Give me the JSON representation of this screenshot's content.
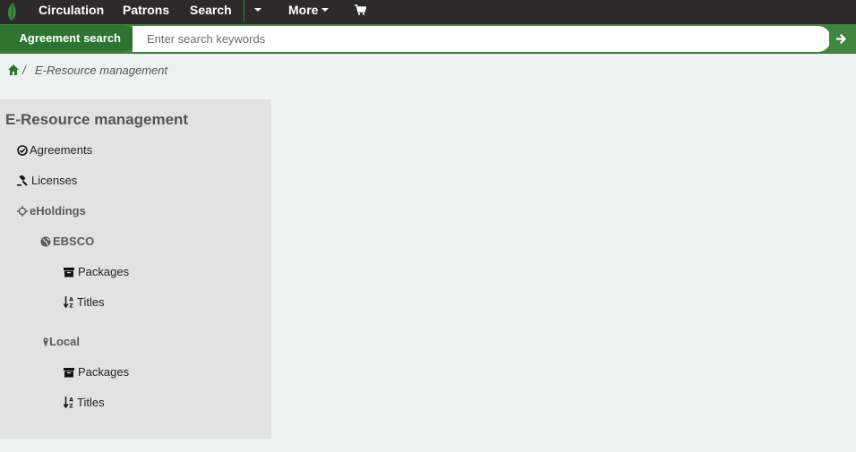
{
  "topnav": {
    "items": [
      {
        "label": "Circulation"
      },
      {
        "label": "Patrons"
      },
      {
        "label": "Search"
      },
      {
        "label": "More"
      }
    ],
    "brand_color": "#408540"
  },
  "search": {
    "label": "Agreement search",
    "placeholder": "Enter search keywords",
    "value": ""
  },
  "breadcrumb": {
    "separator": "/",
    "current": "E-Resource management"
  },
  "sidebar": {
    "title": "E-Resource management",
    "items": [
      {
        "label": "Agreements",
        "icon": "check-circle-icon"
      },
      {
        "label": "Licenses",
        "icon": "gavel-icon"
      },
      {
        "label": "eHoldings",
        "icon": "crosshairs-icon"
      },
      {
        "label": "EBSCO",
        "icon": "globe-icon"
      },
      {
        "label": "Packages",
        "icon": "archive-icon"
      },
      {
        "label": "Titles",
        "icon": "sort-alpha-down-icon"
      },
      {
        "label": "Local",
        "icon": "map-marker-icon"
      },
      {
        "label": "Packages",
        "icon": "archive-icon"
      },
      {
        "label": "Titles",
        "icon": "sort-alpha-down-icon"
      }
    ]
  }
}
